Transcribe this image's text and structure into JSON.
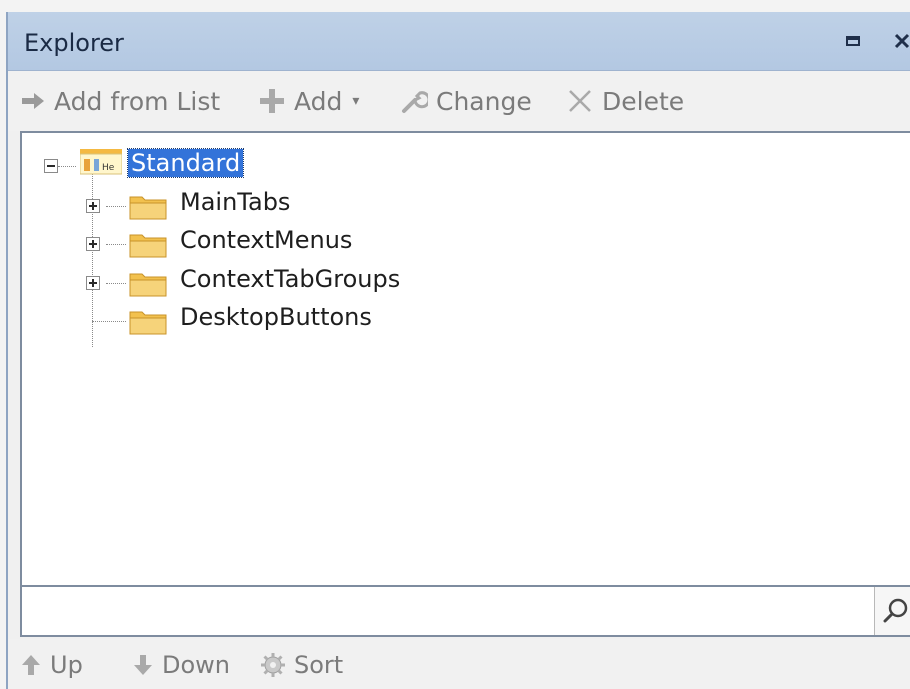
{
  "window": {
    "title": "Explorer",
    "restore_icon": "restore-icon",
    "close_icon": "close-icon"
  },
  "toolbar": {
    "add_from_list": {
      "label": "Add from List",
      "icon": "arrow-right-icon"
    },
    "add": {
      "label": "Add",
      "icon": "plus-icon",
      "dropdown_icon": "caret-down-icon"
    },
    "change": {
      "label": "Change",
      "icon": "wrench-icon"
    },
    "delete": {
      "label": "Delete",
      "icon": "x-icon"
    }
  },
  "tree": {
    "root": {
      "label": "Standard",
      "icon": "ribbon-icon",
      "expanded": true,
      "selected": true
    },
    "children": [
      {
        "label": "MainTabs",
        "icon": "folder-icon",
        "expandable": true
      },
      {
        "label": "ContextMenus",
        "icon": "folder-icon",
        "expandable": true
      },
      {
        "label": "ContextTabGroups",
        "icon": "folder-icon",
        "expandable": true
      },
      {
        "label": "DesktopButtons",
        "icon": "folder-icon",
        "expandable": false
      }
    ]
  },
  "search": {
    "value": "",
    "placeholder": "",
    "icon": "search-icon"
  },
  "bottom_bar": {
    "up": {
      "label": "Up",
      "icon": "arrow-up-icon"
    },
    "down": {
      "label": "Down",
      "icon": "arrow-down-icon"
    },
    "sort": {
      "label": "Sort",
      "icon": "gear-icon"
    }
  },
  "colors": {
    "title_bar": "#b8cce4",
    "selection": "#3373d9",
    "disabled_text": "#7b7b7b",
    "folder": "#f2c14e"
  }
}
